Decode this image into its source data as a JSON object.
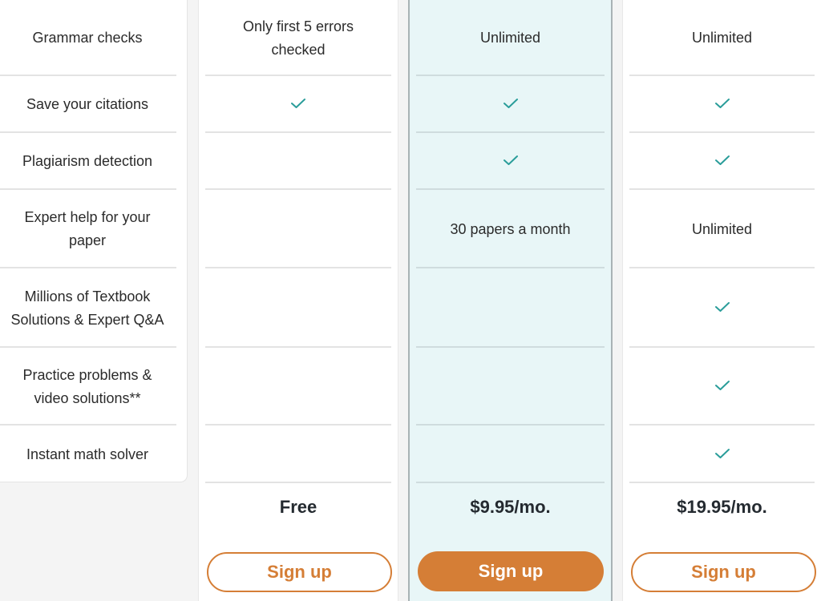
{
  "features": [
    {
      "label": "Grammar checks"
    },
    {
      "label": "Save your citations"
    },
    {
      "label": "Plagiarism detection"
    },
    {
      "label": "Expert help for your paper"
    },
    {
      "label": "Millions of Textbook Solutions & Expert Q&A"
    },
    {
      "label": "Practice problems & video solutions**"
    },
    {
      "label": "Instant math solver"
    }
  ],
  "plans": {
    "free": {
      "values": [
        "Only first 5 errors checked",
        "check",
        "",
        "",
        "",
        "",
        ""
      ],
      "price": "Free",
      "button_label": "Sign up"
    },
    "premium": {
      "values": [
        "Unlimited",
        "check",
        "check",
        "30 papers a month",
        "",
        "",
        ""
      ],
      "price": "$9.95/mo.",
      "button_label": "Sign up",
      "highlighted": true
    },
    "pro": {
      "values": [
        "Unlimited",
        "check",
        "check",
        "Unlimited",
        "check",
        "check",
        "check"
      ],
      "price": "$19.95/mo.",
      "button_label": "Sign up"
    }
  },
  "icons": {
    "check": "checkmark-icon"
  },
  "colors": {
    "accent": "#d57e36",
    "check": "#2a9d9a",
    "highlight_bg": "#e8f6f7",
    "page_bg": "#f4f4f4"
  }
}
